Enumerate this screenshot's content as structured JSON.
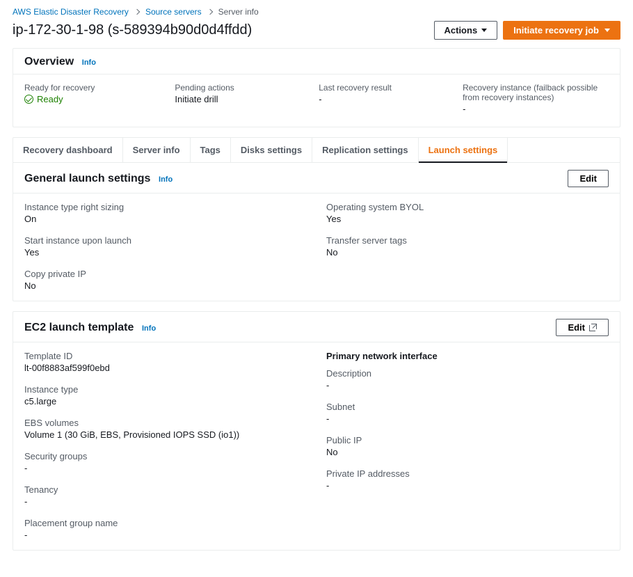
{
  "breadcrumb": {
    "root": "AWS Elastic Disaster Recovery",
    "level2": "Source servers",
    "level3": "Server info"
  },
  "page": {
    "title": "ip-172-30-1-98 (s-589394b90d0d4ffdd)"
  },
  "actions": {
    "menu_label": "Actions",
    "primary_label": "Initiate recovery job"
  },
  "overview": {
    "heading": "Overview",
    "info": "Info",
    "ready_label": "Ready for recovery",
    "ready_value": "Ready",
    "pending_label": "Pending actions",
    "pending_value": "Initiate drill",
    "last_result_label": "Last recovery result",
    "last_result_value": "-",
    "recovery_instance_label": "Recovery instance (failback possible from recovery instances)",
    "recovery_instance_value": "-"
  },
  "tabs": {
    "recovery_dashboard": "Recovery dashboard",
    "server_info": "Server info",
    "tags": "Tags",
    "disks_settings": "Disks settings",
    "replication_settings": "Replication settings",
    "launch_settings": "Launch settings"
  },
  "general_launch": {
    "heading": "General launch settings",
    "info": "Info",
    "edit": "Edit",
    "left": {
      "right_sizing_label": "Instance type right sizing",
      "right_sizing_value": "On",
      "start_label": "Start instance upon launch",
      "start_value": "Yes",
      "copy_ip_label": "Copy private IP",
      "copy_ip_value": "No"
    },
    "right": {
      "os_byol_label": "Operating system BYOL",
      "os_byol_value": "Yes",
      "transfer_tags_label": "Transfer server tags",
      "transfer_tags_value": "No"
    }
  },
  "ec2_template": {
    "heading": "EC2 launch template",
    "info": "Info",
    "edit": "Edit",
    "left": {
      "template_id_label": "Template ID",
      "template_id_value": "lt-00f8883af599f0ebd",
      "instance_type_label": "Instance type",
      "instance_type_value": "c5.large",
      "ebs_label": "EBS volumes",
      "ebs_value": "Volume 1 (30 GiB, EBS, Provisioned IOPS SSD (io1))",
      "sg_label": "Security groups",
      "sg_value": "-",
      "tenancy_label": "Tenancy",
      "tenancy_value": "-",
      "placement_label": "Placement group name",
      "placement_value": "-"
    },
    "right": {
      "heading": "Primary network interface",
      "description_label": "Description",
      "description_value": "-",
      "subnet_label": "Subnet",
      "subnet_value": "-",
      "public_ip_label": "Public IP",
      "public_ip_value": "No",
      "private_ip_label": "Private IP addresses",
      "private_ip_value": "-"
    }
  }
}
